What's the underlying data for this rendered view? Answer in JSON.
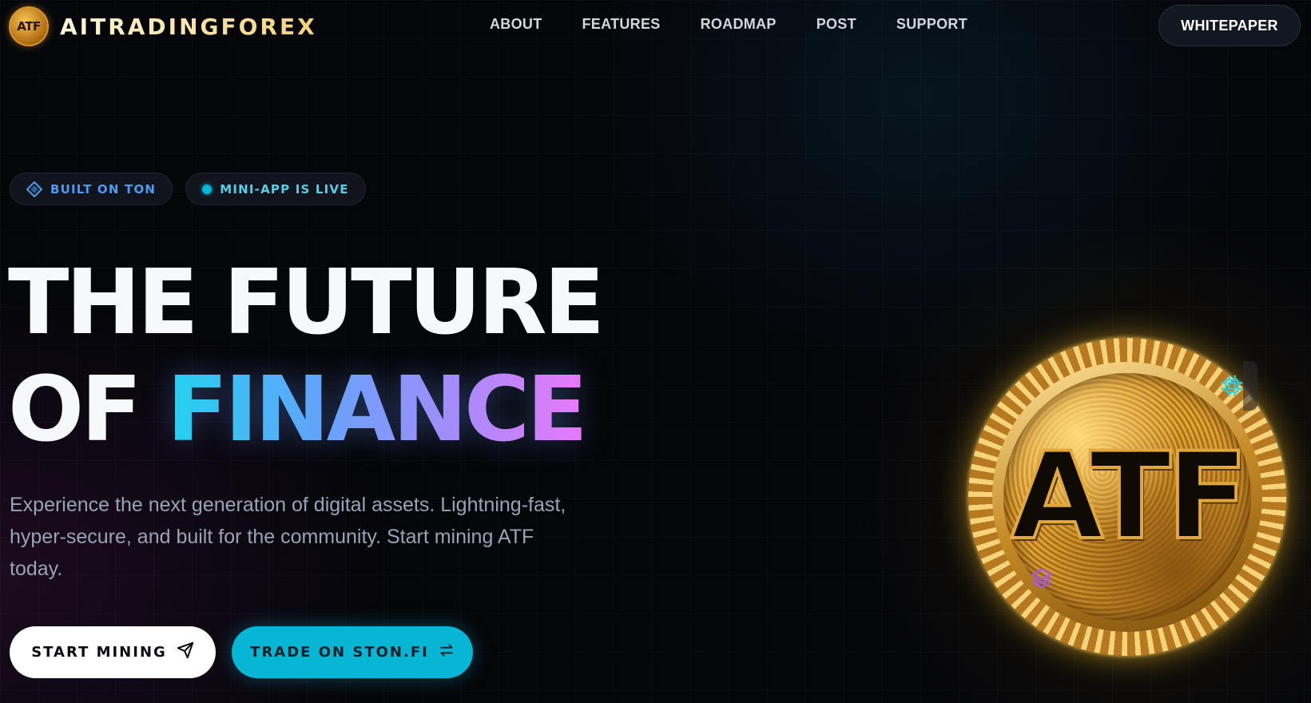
{
  "brand": {
    "logo_text": "ATF",
    "name": "AITRADINGFOREX"
  },
  "nav": {
    "links": [
      "ABOUT",
      "FEATURES",
      "ROADMAP",
      "POST",
      "SUPPORT"
    ],
    "whitepaper_label": "WHITEPAPER"
  },
  "badges": {
    "ton": "BUILT ON TON",
    "live": "MINI-APP IS LIVE"
  },
  "hero": {
    "headline_line1": "THE FUTURE",
    "headline_line2_plain": "OF ",
    "headline_line2_accent": "FINANCE",
    "description": "Experience the next generation of digital assets. Lightning-fast, hyper-secure, and built for the community. Start mining ATF today.",
    "cta_primary": "START MINING",
    "cta_secondary": "TRADE ON STON.FI",
    "coin_text": "ATF"
  },
  "icons": {
    "badge_ton": "diamond-icon",
    "badge_live": "live-dot-icon",
    "cta_primary": "send-icon",
    "cta_secondary": "swap-arrows-icon",
    "coin_top": "chip-icon",
    "coin_bottom": "layers-icon"
  },
  "colors": {
    "background": "#05060a",
    "accent_cyan": "#06b6d4",
    "gradient_start": "#22d3ee",
    "gradient_end": "#e879f9",
    "gold": "#e4a83a"
  }
}
